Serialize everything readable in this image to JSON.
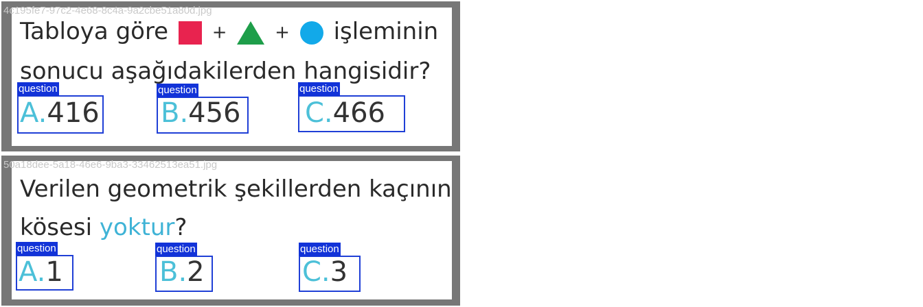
{
  "samples": [
    {
      "filename": "4c195fe7-97c2-4e68-8c4a-9a2cbe51a80d.jpg",
      "question_line_1_before": "Tabloya göre",
      "plus_sign": "+",
      "question_line_1_after": "işleminin",
      "question_line_2": "sonucu aşağıdakilerden hangisidir?",
      "shapes": [
        "square",
        "triangle",
        "circle"
      ],
      "shape_colors": [
        "#e8234f",
        "#1e9e4a",
        "#12a9e9"
      ],
      "options": [
        {
          "letter": "A.",
          "value": "416",
          "label": "question"
        },
        {
          "letter": "B.",
          "value": "456",
          "label": "question"
        },
        {
          "letter": "C.",
          "value": "466",
          "label": "question"
        }
      ]
    },
    {
      "filename": "50a18dee-5a18-46e6-9ba3-33462513ea51.jpg",
      "question_line_1": "Verilen geometrik şekillerden kaçının",
      "question_line_2_before": "kösesi",
      "question_line_2_accent": "yoktur",
      "question_line_2_after": "?",
      "options": [
        {
          "letter": "A.",
          "value": "1",
          "label": "question"
        },
        {
          "letter": "B.",
          "value": "2",
          "label": "question"
        },
        {
          "letter": "C.",
          "value": "3",
          "label": "question"
        }
      ]
    }
  ],
  "colors": {
    "box": "#1f3fd6",
    "tag_background": "#1233d8",
    "option_letter": "#4cc0d8",
    "accent_text": "#3fb3d6"
  }
}
